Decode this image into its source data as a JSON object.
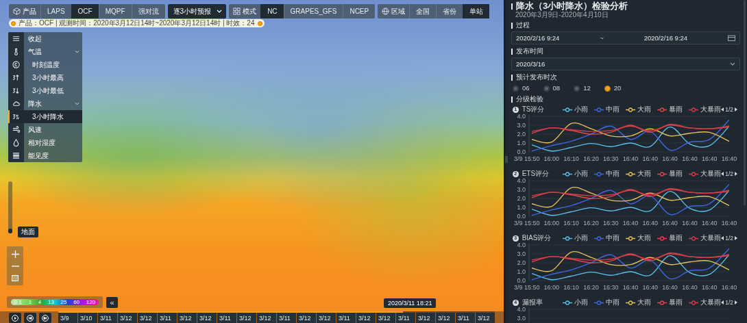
{
  "toolbar": [
    {
      "kind": "tabs",
      "label": "产品",
      "items": [
        {
          "label": "LAPS",
          "selected": false
        },
        {
          "label": "OCF",
          "selected": true
        },
        {
          "label": "MQPF",
          "selected": false
        },
        {
          "label": "强对流",
          "selected": false
        }
      ]
    },
    {
      "kind": "select",
      "value": "逐3小时预报"
    },
    {
      "kind": "tabs",
      "label": "模式",
      "items": [
        {
          "label": "NC",
          "selected": true
        },
        {
          "label": "GRAPES_GFS",
          "selected": false
        },
        {
          "label": "NCEP",
          "selected": false
        }
      ]
    },
    {
      "kind": "tabs",
      "label": "区域",
      "items": [
        {
          "label": "全国",
          "selected": false
        },
        {
          "label": "省份",
          "selected": false
        },
        {
          "label": "单站",
          "selected": true
        }
      ]
    }
  ],
  "info_bar": {
    "text": "产品：OCF | 观测时间：2020年3月12日14时~2020年3月12日14时 | 时效：24"
  },
  "layer_menu": {
    "items": [
      {
        "label": "收起",
        "selected": false
      },
      {
        "label": "气温",
        "selected": false,
        "expanded": true,
        "children": [
          {
            "label": "时刻温度",
            "selected": false
          },
          {
            "label": "3小时最高",
            "selected": false
          },
          {
            "label": "3小时最低",
            "selected": false
          }
        ]
      },
      {
        "label": "降水",
        "selected": false,
        "expanded": true,
        "children": [
          {
            "label": "3小时降水",
            "selected": true
          }
        ]
      },
      {
        "label": "风速",
        "selected": false
      },
      {
        "label": "相对湿度",
        "selected": false
      },
      {
        "label": "能见度",
        "selected": false
      }
    ]
  },
  "layer_slider": {
    "level": 0,
    "label": "地面"
  },
  "color_legend": {
    "labels": [
      "0.1",
      "1",
      "4",
      "13",
      "25",
      "60",
      "120"
    ],
    "collapse": "«"
  },
  "timeline": {
    "level": 0.79,
    "tooltip": "2020/3/11 18:21",
    "dates": [
      "3/9",
      "3/10",
      "3/11",
      "3/12",
      "3/12",
      "3/11",
      "3/12",
      "3/12",
      "3/11",
      "3/12",
      "3/12",
      "3/11",
      "3/12",
      "3/12",
      "3/11",
      "3/12",
      "3/12",
      "3/11",
      "3/12",
      "3/12",
      "3/11",
      "3/12"
    ]
  },
  "panel": {
    "title": "降水（3小时降水）检验分析",
    "subtitle": "2020年3月9日-2020年4月10日",
    "process": {
      "label": "过程",
      "start": "2020/2/16 9:24",
      "separator": "~",
      "end": "2020/2/16 9:24"
    },
    "publish_time": {
      "label": "发布时间",
      "value": "2020/3/16"
    },
    "release_times": {
      "label": "预计发布时次",
      "options": [
        {
          "label": "06",
          "selected": false
        },
        {
          "label": "08",
          "selected": false
        },
        {
          "label": "12",
          "selected": false
        },
        {
          "label": "20",
          "selected": true
        }
      ]
    },
    "grading": {
      "label": "分级检验",
      "charts": [
        {
          "number": "1",
          "pager": "1/2",
          "chart_data": {
            "type": "line",
            "title": "TS评分",
            "grid": true,
            "categories": [
              "3/9 15:50",
              "16:00",
              "16:10",
              "16:20",
              "16:30",
              "16:40",
              "16:40",
              "16:40",
              "16:40",
              "16:40",
              "16:40"
            ],
            "ylim": [
              0,
              4
            ],
            "yticks": [
              {
                "value": 0,
                "label": "0.0"
              },
              {
                "value": 1,
                "label": "1.0"
              },
              {
                "value": 2,
                "label": "2.0"
              },
              {
                "value": 3,
                "label": "3.0"
              },
              {
                "value": 4,
                "label": "4.0"
              }
            ],
            "series": [
              {
                "name": "小雨",
                "color": "#5bc0eb",
                "values": [
                  0.8,
                  0.1,
                  0.5,
                  0.95,
                  0.6,
                  1.0,
                  0.6,
                  2.8,
                  0.9,
                  0.7,
                  2.9
                ]
              },
              {
                "name": "中雨",
                "color": "#3f66e0",
                "values": [
                  0.1,
                  0.7,
                  1.2,
                  2.0,
                  2.9,
                  1.4,
                  2.3,
                  0.2,
                  1.1,
                  1.4,
                  3.6
                ]
              },
              {
                "name": "大雨",
                "color": "#e8c15a",
                "values": [
                  1.4,
                  1.1,
                  3.2,
                  2.6,
                  1.8,
                  1.8,
                  2.6,
                  1.8,
                  2.1,
                  2.2,
                  1.2
                ]
              },
              {
                "name": "暴雨",
                "color": "#e0474c",
                "values": [
                  2.1,
                  2.7,
                  2.4,
                  2.0,
                  2.2,
                  3.0,
                  2.2,
                  3.1,
                  2.7,
                  2.6,
                  2.9
                ]
              },
              {
                "name": "大暴雨",
                "color": "#d63a48",
                "values": [
                  2.3,
                  2.7,
                  2.5,
                  2.3,
                  2.4,
                  2.9,
                  2.4,
                  3.0,
                  2.7,
                  2.6,
                  2.8
                ]
              }
            ]
          }
        },
        {
          "number": "2",
          "pager": "1/2",
          "chart_data": {
            "type": "line",
            "title": "ETS评分",
            "grid": true,
            "categories": [
              "3/9 15:50",
              "16:00",
              "16:10",
              "16:20",
              "16:30",
              "16:40",
              "16:40",
              "16:40",
              "16:40",
              "16:40",
              "16:40"
            ],
            "ylim": [
              0,
              4
            ],
            "yticks": [
              {
                "value": 0,
                "label": "0.0"
              },
              {
                "value": 1,
                "label": "1.0"
              },
              {
                "value": 2,
                "label": "2.0"
              },
              {
                "value": 3,
                "label": "3.0"
              },
              {
                "value": 4,
                "label": "4.0"
              }
            ],
            "series": [
              {
                "name": "小雨",
                "color": "#5bc0eb",
                "values": [
                  0.8,
                  0.1,
                  0.5,
                  0.95,
                  0.6,
                  1.0,
                  0.6,
                  2.8,
                  0.9,
                  0.7,
                  2.9
                ]
              },
              {
                "name": "中雨",
                "color": "#3f66e0",
                "values": [
                  0.1,
                  0.7,
                  1.2,
                  2.0,
                  2.9,
                  1.4,
                  2.3,
                  0.2,
                  1.1,
                  1.4,
                  3.6
                ]
              },
              {
                "name": "大雨",
                "color": "#e8c15a",
                "values": [
                  1.4,
                  1.1,
                  3.2,
                  2.6,
                  1.8,
                  1.8,
                  2.6,
                  1.8,
                  2.1,
                  2.2,
                  1.2
                ]
              },
              {
                "name": "暴雨",
                "color": "#e0474c",
                "values": [
                  2.1,
                  2.7,
                  2.4,
                  2.0,
                  2.2,
                  3.0,
                  2.2,
                  3.1,
                  2.7,
                  2.6,
                  2.9
                ]
              },
              {
                "name": "大暴雨",
                "color": "#d63a48",
                "values": [
                  2.3,
                  2.7,
                  2.5,
                  2.3,
                  2.4,
                  2.9,
                  2.4,
                  3.0,
                  2.7,
                  2.6,
                  2.8
                ]
              }
            ]
          }
        },
        {
          "number": "3",
          "pager": "1/2",
          "chart_data": {
            "type": "line",
            "title": "BIAS评分",
            "grid": true,
            "categories": [
              "3/9 15:50",
              "16:00",
              "16:10",
              "16:20",
              "16:30",
              "16:40",
              "16:40",
              "16:40",
              "16:40",
              "16:40",
              "16:40"
            ],
            "ylim": [
              0,
              4
            ],
            "yticks": [
              {
                "value": 0,
                "label": "0.0"
              },
              {
                "value": 1,
                "label": "1.0"
              },
              {
                "value": 2,
                "label": "2.0"
              },
              {
                "value": 3,
                "label": "3.0"
              },
              {
                "value": 4,
                "label": "4.0"
              }
            ],
            "series": [
              {
                "name": "小雨",
                "color": "#5bc0eb",
                "values": [
                  0.8,
                  0.1,
                  0.5,
                  0.95,
                  0.6,
                  1.0,
                  0.6,
                  2.8,
                  0.9,
                  0.7,
                  2.9
                ]
              },
              {
                "name": "中雨",
                "color": "#3f66e0",
                "values": [
                  0.1,
                  0.7,
                  1.2,
                  2.0,
                  2.9,
                  1.4,
                  2.3,
                  0.2,
                  1.1,
                  1.4,
                  3.6
                ]
              },
              {
                "name": "大雨",
                "color": "#e8c15a",
                "values": [
                  1.4,
                  1.1,
                  3.2,
                  2.6,
                  1.8,
                  1.8,
                  2.6,
                  1.8,
                  2.1,
                  2.2,
                  1.2
                ]
              },
              {
                "name": "暴雨",
                "color": "#e0474c",
                "values": [
                  2.1,
                  2.7,
                  2.4,
                  2.0,
                  2.2,
                  3.0,
                  2.2,
                  3.1,
                  2.7,
                  2.6,
                  2.9
                ]
              },
              {
                "name": "大暴雨",
                "color": "#d63a48",
                "values": [
                  2.3,
                  2.7,
                  2.5,
                  2.3,
                  2.4,
                  2.9,
                  2.4,
                  3.0,
                  2.7,
                  2.6,
                  2.8
                ]
              }
            ]
          }
        },
        {
          "number": "4",
          "pager": "1/2",
          "chart_data": {
            "type": "line",
            "title": "漏报率",
            "grid": true,
            "ylim": [
              0,
              4
            ],
            "yticks": [
              {
                "value": 3,
                "label": "3.0"
              },
              {
                "value": 4,
                "label": "4.0"
              }
            ],
            "series": [
              {
                "name": "小雨",
                "color": "#5bc0eb"
              },
              {
                "name": "中雨",
                "color": "#3f66e0"
              },
              {
                "name": "大雨",
                "color": "#e8c15a"
              },
              {
                "name": "暴雨",
                "color": "#e0474c"
              },
              {
                "name": "大暴雨",
                "color": "#d63a48"
              }
            ]
          }
        }
      ]
    }
  }
}
